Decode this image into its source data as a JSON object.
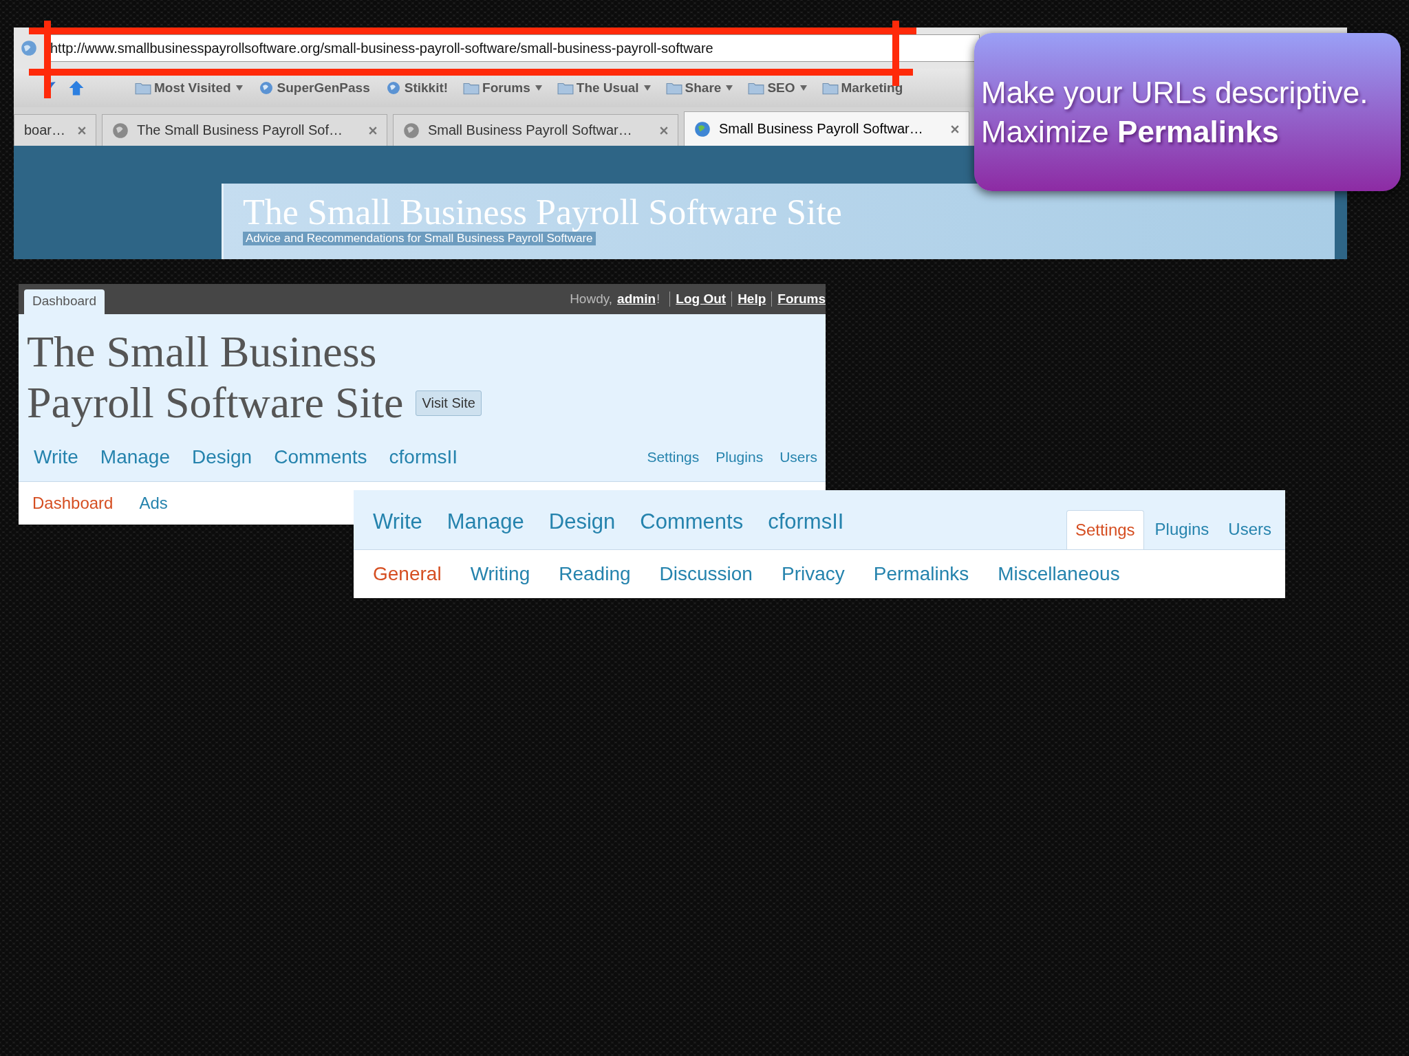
{
  "browser": {
    "address": "http://www.smallbusinesspayrollsoftware.org/small-business-payroll-software/small-business-payroll-software",
    "bookmarks": [
      {
        "label": "Most Visited",
        "kind": "folder",
        "menu": true
      },
      {
        "label": "SuperGenPass",
        "kind": "globe",
        "menu": false
      },
      {
        "label": "Stikkit!",
        "kind": "globe",
        "menu": false
      },
      {
        "label": "Forums",
        "kind": "folder",
        "menu": true
      },
      {
        "label": "The Usual",
        "kind": "folder",
        "menu": true
      },
      {
        "label": "Share",
        "kind": "folder",
        "menu": true
      },
      {
        "label": "SEO",
        "kind": "folder",
        "menu": true
      },
      {
        "label": "Marketing",
        "kind": "folder",
        "menu": false
      }
    ],
    "tabs": [
      {
        "title": "boar…",
        "selected": false,
        "icon": false
      },
      {
        "title": "The Small Business Payroll Sof…",
        "selected": false,
        "icon": true
      },
      {
        "title": "Small Business Payroll Softwar…",
        "selected": false,
        "icon": true
      },
      {
        "title": "Small Business Payroll Softwar…",
        "selected": true,
        "icon": true
      }
    ],
    "site_header": {
      "title": "The Small Business Payroll Software Site",
      "tagline": "Advice and Recommendations for Small Business Payroll Software"
    }
  },
  "callout": {
    "lines": [
      "Make your URLs descriptive.",
      "Maximize **Permalinks**"
    ]
  },
  "admin_panel": {
    "tab": "Dashboard",
    "greeting": "Howdy,",
    "user": "admin",
    "greeting_end": "!",
    "links": [
      "Log Out",
      "Help",
      "Forums"
    ],
    "site_title_lines": [
      "The Small Business",
      "Payroll Software Site"
    ],
    "visit_button": "Visit Site",
    "main_menu": [
      {
        "label": "Write",
        "selected": false
      },
      {
        "label": "Manage",
        "selected": false
      },
      {
        "label": "Design",
        "selected": false
      },
      {
        "label": "Comments",
        "selected": false
      },
      {
        "label": "cformsII",
        "selected": false
      }
    ],
    "side_menu": [
      {
        "label": "Settings",
        "selected": false
      },
      {
        "label": "Plugins",
        "selected": false
      },
      {
        "label": "Users",
        "selected": false
      }
    ],
    "submenu": [
      {
        "label": "Dashboard",
        "selected": true
      },
      {
        "label": "Ads",
        "selected": false
      }
    ]
  },
  "settings_panel": {
    "main_menu": [
      {
        "label": "Write",
        "selected": false
      },
      {
        "label": "Manage",
        "selected": false
      },
      {
        "label": "Design",
        "selected": false
      },
      {
        "label": "Comments",
        "selected": false
      },
      {
        "label": "cformsII",
        "selected": false
      }
    ],
    "side_menu": [
      {
        "label": "Settings",
        "selected": true
      },
      {
        "label": "Plugins",
        "selected": false
      },
      {
        "label": "Users",
        "selected": false
      }
    ],
    "submenu": [
      {
        "label": "General",
        "selected": true
      },
      {
        "label": "Writing",
        "selected": false
      },
      {
        "label": "Reading",
        "selected": false
      },
      {
        "label": "Discussion",
        "selected": false
      },
      {
        "label": "Privacy",
        "selected": false
      },
      {
        "label": "Permalinks",
        "selected": false
      },
      {
        "label": "Miscellaneous",
        "selected": false
      }
    ]
  }
}
